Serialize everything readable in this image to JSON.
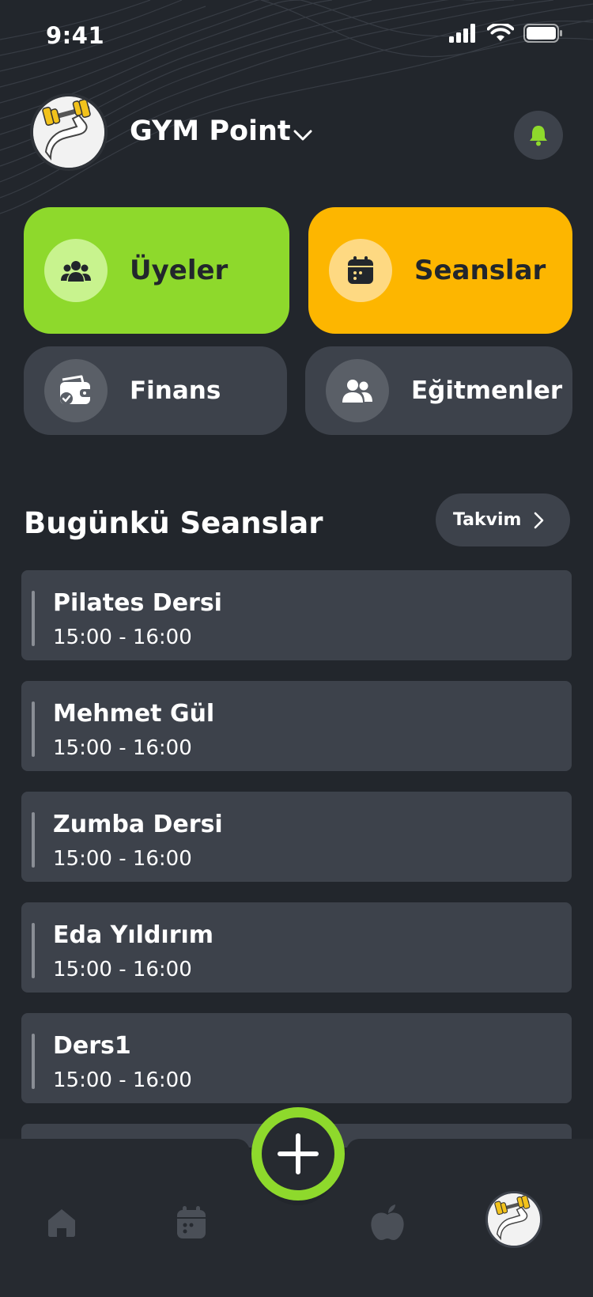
{
  "status_bar": {
    "time": "9:41"
  },
  "header": {
    "gym_name": "GYM Point"
  },
  "tiles": {
    "uyeler": "Üyeler",
    "seanslar": "Seanslar",
    "finans": "Finans",
    "egitmenler": "Eğitmenler"
  },
  "todays_sessions": {
    "title": "Bugünkü Seanslar",
    "calendar_button": "Takvim",
    "items": [
      {
        "title": "Pilates Dersi",
        "time": "15:00 - 16:00"
      },
      {
        "title": "Mehmet Gül",
        "time": "15:00 - 16:00"
      },
      {
        "title": "Zumba Dersi",
        "time": "15:00 - 16:00"
      },
      {
        "title": "Eda Yıldırım",
        "time": "15:00 - 16:00"
      },
      {
        "title": "Ders1",
        "time": "15:00 - 16:00"
      }
    ]
  },
  "colors": {
    "background": "#22262c",
    "card": "#3d424b",
    "accent_green": "#8ed92c",
    "accent_yellow": "#fdb600"
  },
  "icons": {
    "bell": "bell-icon",
    "members": "users-icon",
    "sessions": "calendar-icon",
    "finance": "wallet-icon",
    "trainers": "trainers-icon",
    "home": "home-icon",
    "nutrition": "apple-icon",
    "add": "plus-icon"
  }
}
